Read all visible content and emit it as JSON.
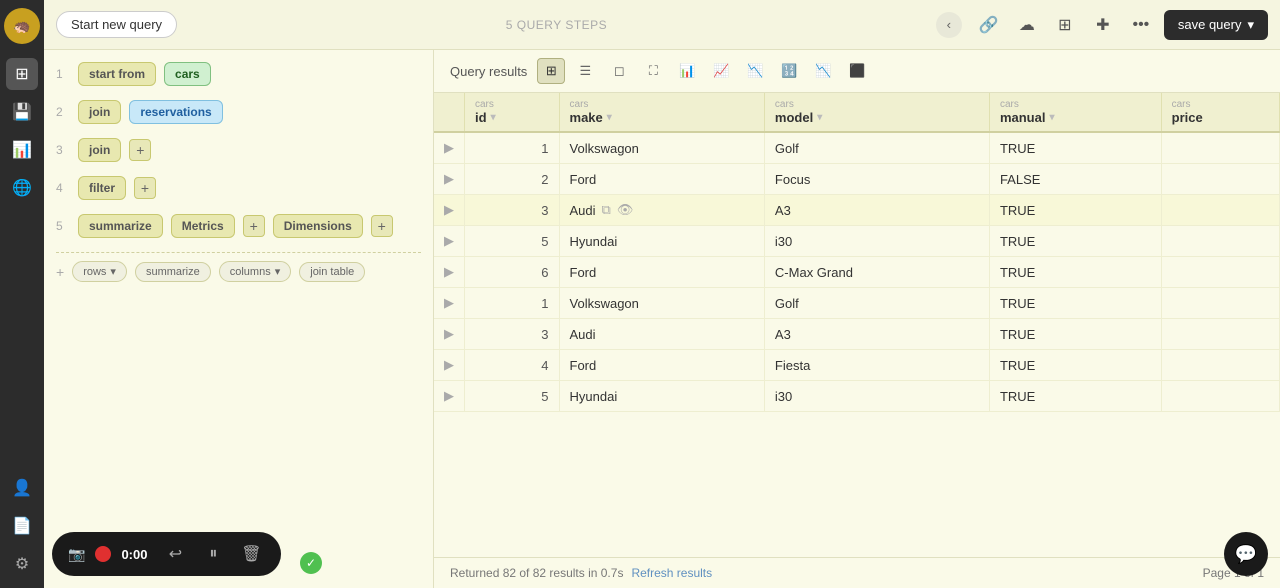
{
  "sidebar": {
    "logo": "🦔",
    "icons": [
      {
        "name": "home-icon",
        "glyph": "⊞",
        "active": true
      },
      {
        "name": "save-icon",
        "glyph": "💾",
        "active": false
      },
      {
        "name": "chart-icon",
        "glyph": "📊",
        "active": false
      },
      {
        "name": "globe-icon",
        "glyph": "🌐",
        "active": false
      },
      {
        "name": "user-icon",
        "glyph": "👤",
        "active": false
      },
      {
        "name": "document-icon",
        "glyph": "📄",
        "active": false
      },
      {
        "name": "settings-icon",
        "glyph": "⚙",
        "active": false
      }
    ]
  },
  "topbar": {
    "start_new_label": "Start new query",
    "query_steps_label": "5 QUERY STEPS",
    "save_label": "save query"
  },
  "query_panel": {
    "steps": [
      {
        "num": "1",
        "tags": [
          {
            "label": "start from",
            "type": "default"
          },
          {
            "label": "cars",
            "type": "green"
          }
        ]
      },
      {
        "num": "2",
        "tags": [
          {
            "label": "join",
            "type": "default"
          },
          {
            "label": "reservations",
            "type": "blue"
          }
        ]
      },
      {
        "num": "3",
        "tags": [
          {
            "label": "join",
            "type": "default"
          }
        ],
        "has_plus": true
      },
      {
        "num": "4",
        "tags": [
          {
            "label": "filter",
            "type": "default"
          }
        ],
        "has_plus": true
      },
      {
        "num": "5",
        "tags": [
          {
            "label": "summarize",
            "type": "default"
          },
          {
            "label": "Metrics",
            "type": "default"
          },
          {
            "label": "Dimensions",
            "type": "default"
          }
        ],
        "has_plus_metrics": true,
        "has_plus_dims": true
      }
    ],
    "bottom_actions": [
      {
        "label": "+ rows",
        "has_caret": true
      },
      {
        "label": "summarize"
      },
      {
        "label": "columns",
        "has_caret": true
      },
      {
        "label": "join table"
      }
    ]
  },
  "results": {
    "query_results_label": "Query results",
    "view_icons": [
      "⊞",
      "☰",
      "◻",
      "⛶",
      "📊",
      "📈",
      "📉",
      "🔢",
      "📉",
      "⬛"
    ],
    "columns": [
      {
        "category": "cars",
        "name": "id"
      },
      {
        "category": "cars",
        "name": "make"
      },
      {
        "category": "cars",
        "name": "model"
      },
      {
        "category": "cars",
        "name": "manual"
      },
      {
        "category": "cars",
        "name": "price"
      }
    ],
    "rows": [
      {
        "expand": "▶",
        "id": "1",
        "make": "Volkswagon",
        "model": "Golf",
        "manual": "TRUE",
        "price": ""
      },
      {
        "expand": "▶",
        "id": "2",
        "make": "Ford",
        "model": "Focus",
        "manual": "FALSE",
        "price": ""
      },
      {
        "expand": "▶",
        "id": "3",
        "make": "Audi",
        "model": "A3",
        "manual": "TRUE",
        "price": "",
        "highlight": true
      },
      {
        "expand": "▶",
        "id": "5",
        "make": "Hyundai",
        "model": "i30",
        "manual": "TRUE",
        "price": ""
      },
      {
        "expand": "▶",
        "id": "6",
        "make": "Ford",
        "model": "C-Max Grand",
        "manual": "TRUE",
        "price": ""
      },
      {
        "expand": "▶",
        "id": "1",
        "make": "Volkswagon",
        "model": "Golf",
        "manual": "TRUE",
        "price": ""
      },
      {
        "expand": "▶",
        "id": "3",
        "make": "Audi",
        "model": "A3",
        "manual": "TRUE",
        "price": ""
      },
      {
        "expand": "▶",
        "id": "4",
        "make": "Ford",
        "model": "Fiesta",
        "manual": "TRUE",
        "price": ""
      },
      {
        "expand": "▶",
        "id": "5",
        "make": "Hyundai",
        "model": "i30",
        "manual": "TRUE",
        "price": ""
      }
    ],
    "status": "Returned 82 of 82 results in 0.7s",
    "refresh_label": "Refresh results",
    "page_info": "Page 1 of 1"
  },
  "recording": {
    "time": "0:00"
  }
}
